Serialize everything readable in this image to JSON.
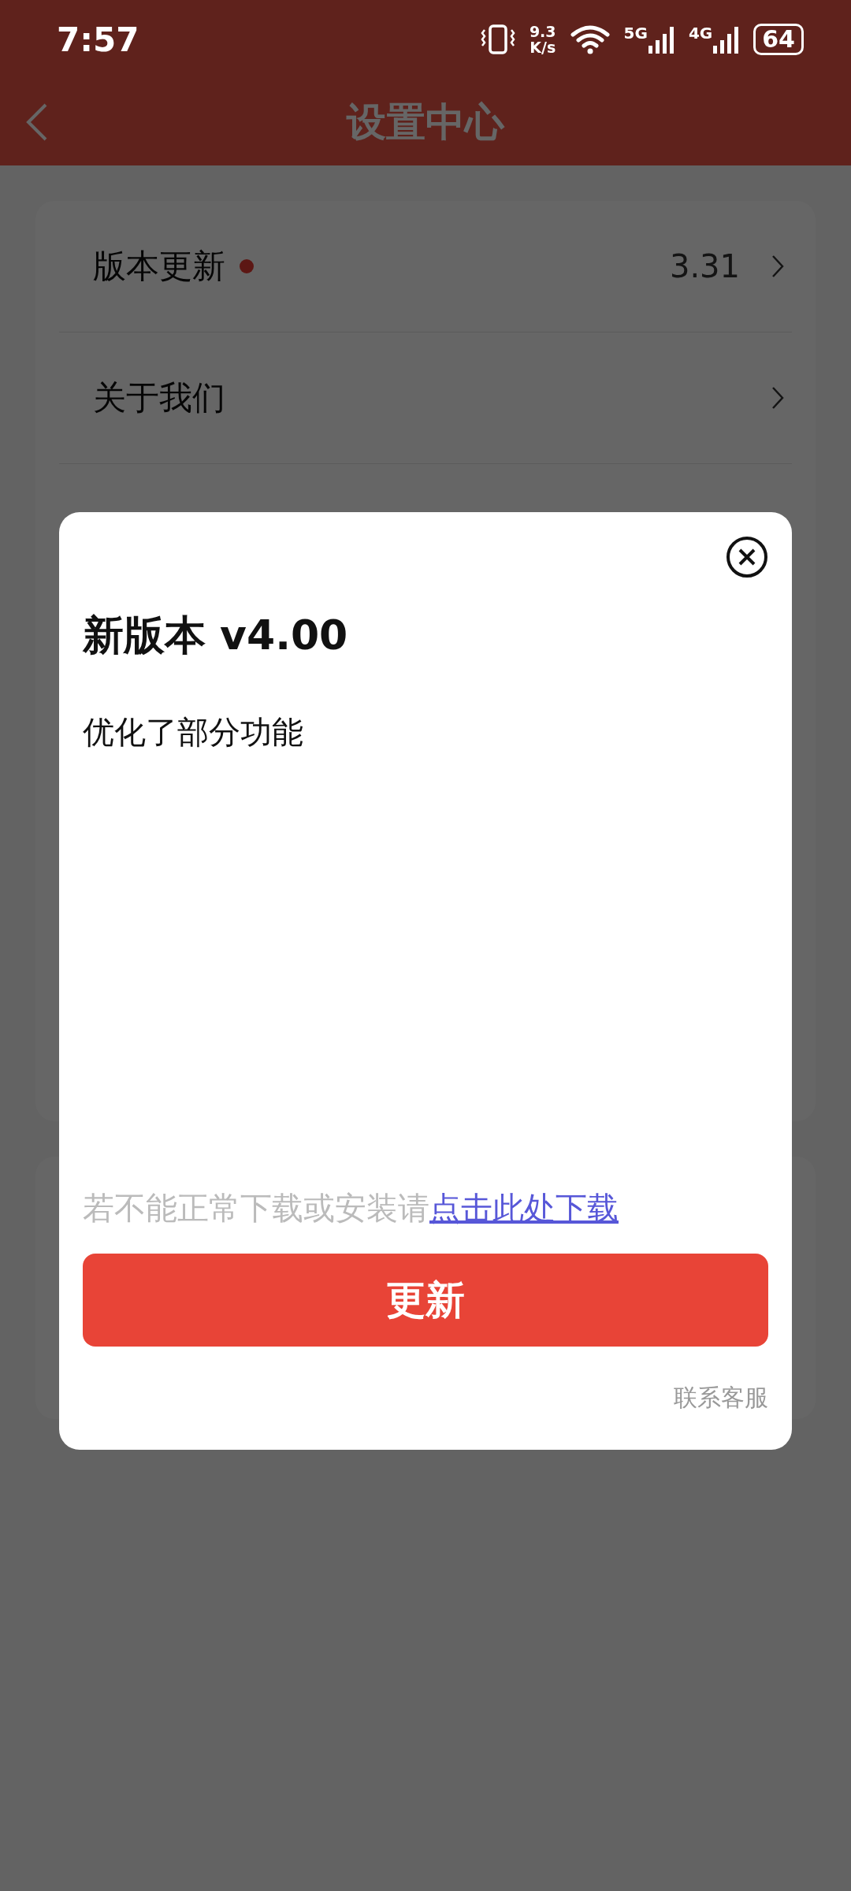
{
  "status_bar": {
    "time": "7:57",
    "net_speed_value": "9.3",
    "net_speed_unit": "K/s",
    "network_1": "5G",
    "network_2": "4G",
    "battery": "64"
  },
  "header": {
    "title": "设置中心"
  },
  "settings_card": {
    "rows": [
      {
        "text": "版本更新",
        "badge": true,
        "value": "3.31"
      },
      {
        "text": "关于我们",
        "badge": false
      }
    ]
  },
  "dialog": {
    "title": "新版本 v4.00",
    "body": "优化了部分功能",
    "hint": "若不能正常下载或安装请",
    "link": "点击此处下载",
    "button": "更新",
    "contact": "联系客服"
  }
}
